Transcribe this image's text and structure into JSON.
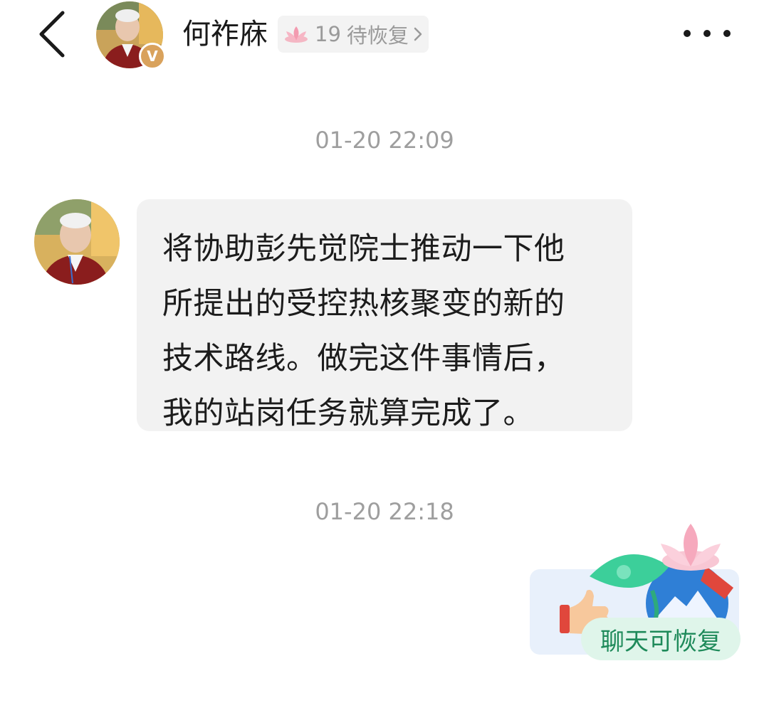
{
  "header": {
    "back_icon": "chevron-left-icon",
    "contact_name": "何祚庥",
    "verified_badge": "V",
    "status_count": "19",
    "status_text": "待恢复",
    "status_icon": "lotus-icon",
    "more_icon": "more-dots-icon"
  },
  "messages": [
    {
      "timestamp": "01-20 22:09",
      "lines": [
        "将协助彭先觉院士推动一下他",
        "所提出的受控热核聚变的新的",
        "技术路线。做完这件事情后，",
        "我的站岗任务就算完成了。"
      ]
    },
    {
      "timestamp": "01-20 22:18",
      "sticker_label": "聊天可恢复"
    }
  ],
  "colors": {
    "accent_green": "#1e8a5a",
    "badge_gold": "#d9a25c",
    "bubble_bg": "#f2f2f2",
    "timestamp_gray": "#9e9e9e"
  }
}
